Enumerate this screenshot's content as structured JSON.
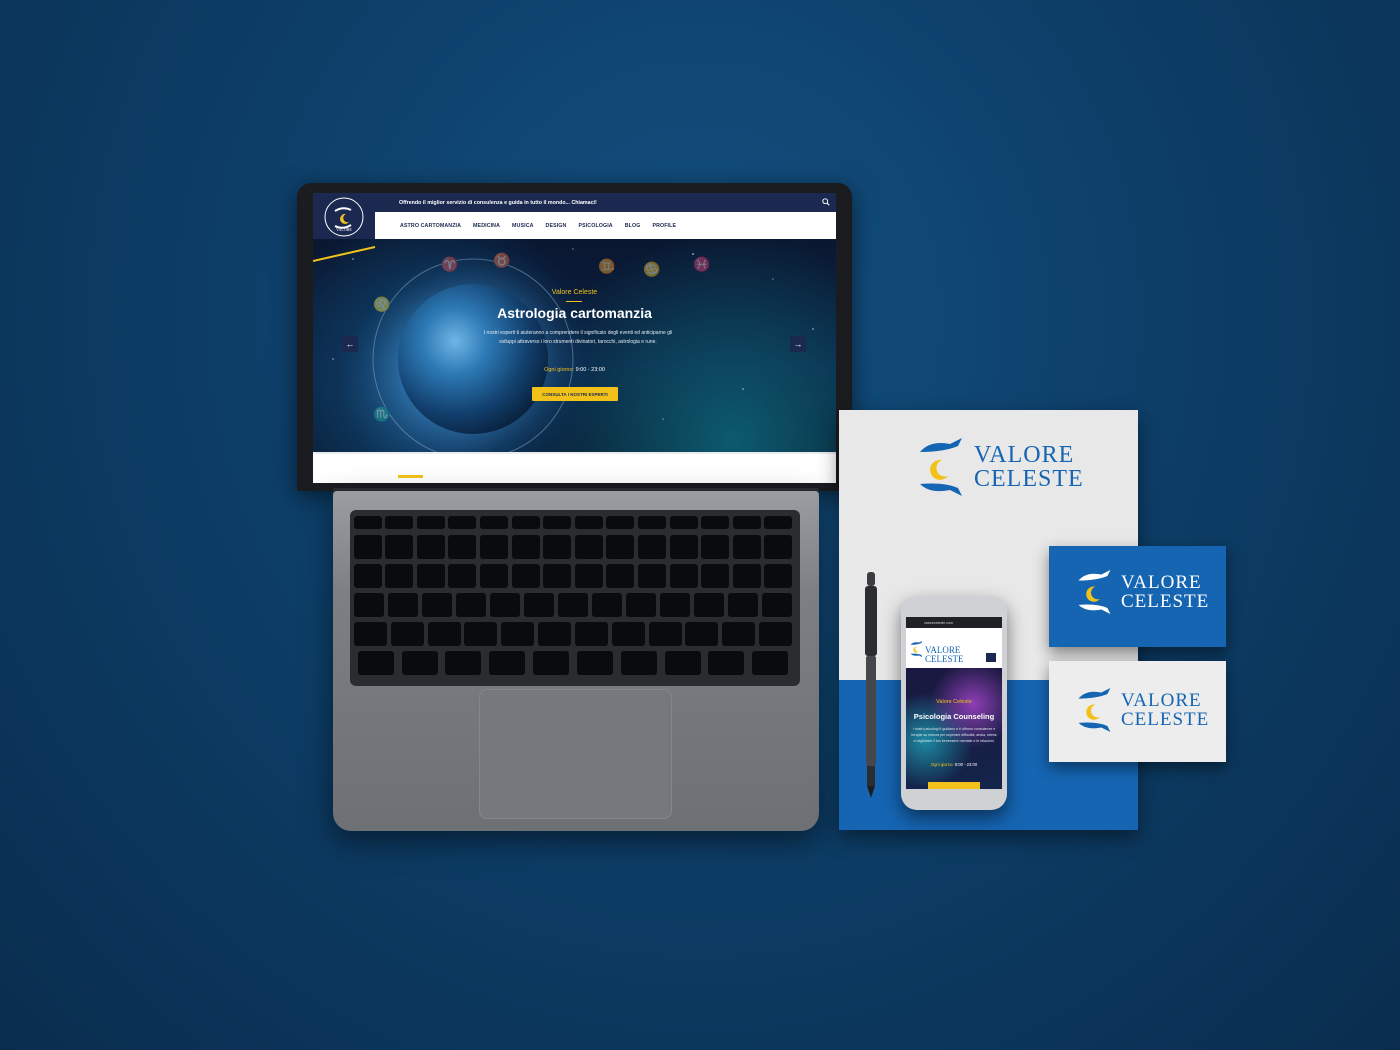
{
  "brand": {
    "line1": "VALORE",
    "line2": "CELESTE",
    "color_primary": "#1565b3",
    "color_navy": "#1b2951",
    "color_accent": "#f2c21a"
  },
  "laptop_site": {
    "logo": "logo-valore-celeste",
    "topbar_text": "Offrendo il miglior servizio di consulenza e guida in tutto il mondo... Chiamaci!",
    "search_icon": "search-icon",
    "nav": [
      "ASTRO CARTOMANZIA",
      "MEDICINA",
      "MUSICA",
      "DESIGN",
      "PSICOLOGIA",
      "BLOG",
      "PROFILE"
    ],
    "hero": {
      "eyebrow": "Valore Celeste",
      "title": "Astrologia cartomanzia",
      "text": "I nostri esperti ti aiuteranno a comprendere il significato degli eventi ed anticiparne gli sviluppi attraverso i loro strumenti divinatori, tarocchi, astrologia e rune.",
      "hours_label": "Ogni giorno:",
      "hours_value": "9:00 - 23:00",
      "cta": "CONSULTA I NOSTRI ESPERTI",
      "prev_arrow": "←",
      "next_arrow": "→"
    }
  },
  "phone_site": {
    "url": "valoreceleste.com",
    "logo_line1": "VALORE",
    "logo_line2": "CELESTE",
    "hero": {
      "eyebrow": "Valore Celeste",
      "title": "Psicologia Counseling",
      "text": "I nostri psicologi ti guidano e ti offrono consulenze e terapie su misura per superare difficoltà, ansia, stress e migliorare il tuo benessere mentale e le relazioni.",
      "hours_label": "Ogni giorno:",
      "hours_value": "9:00 - 23:00"
    }
  }
}
